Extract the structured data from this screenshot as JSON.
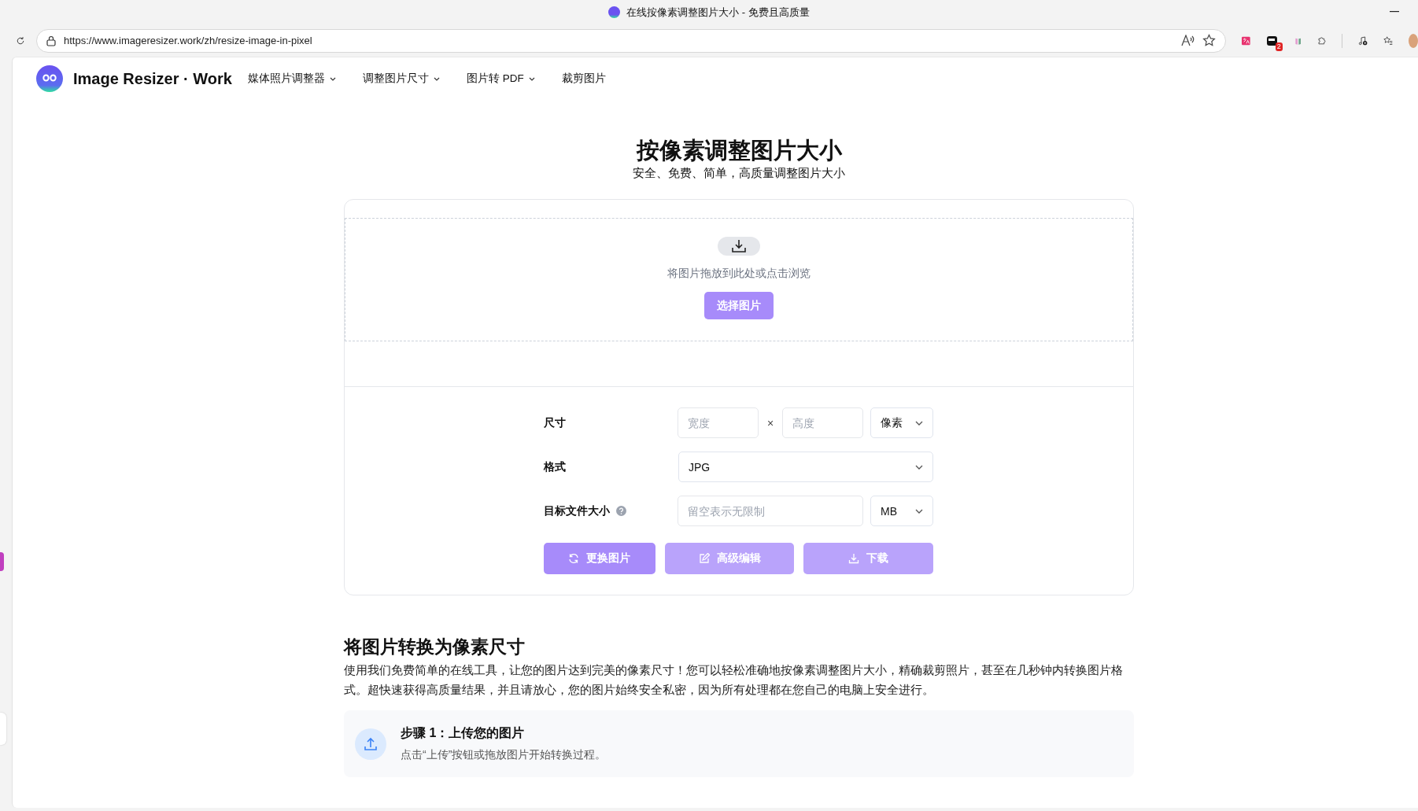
{
  "browser": {
    "tab_title": "在线按像素调整图片大小 - 免费且高质量",
    "url": "https://www.imageresizer.work/zh/resize-image-in-pixel",
    "extension_badge": "2"
  },
  "site": {
    "brand": "Image Resizer · Work",
    "nav": [
      {
        "label": "媒体照片调整器",
        "dropdown": true
      },
      {
        "label": "调整图片尺寸",
        "dropdown": true
      },
      {
        "label": "图片转 PDF",
        "dropdown": true
      },
      {
        "label": "裁剪图片",
        "dropdown": false
      }
    ]
  },
  "hero": {
    "title": "按像素调整图片大小",
    "subtitle": "安全、免费、简单，高质量调整图片大小"
  },
  "upload": {
    "hint": "将图片拖放到此处或点击浏览",
    "button": "选择图片"
  },
  "size": {
    "label": "尺寸",
    "width_placeholder": "宽度",
    "separator": "×",
    "height_placeholder": "高度",
    "unit": "像素"
  },
  "format": {
    "label": "格式",
    "value": "JPG"
  },
  "target_size": {
    "label": "目标文件大小",
    "placeholder": "留空表示无限制",
    "unit": "MB"
  },
  "actions": [
    {
      "label": "更换图片",
      "kind": "refresh",
      "disabled": false
    },
    {
      "label": "高级编辑",
      "kind": "edit",
      "disabled": true
    },
    {
      "label": "下载",
      "kind": "download",
      "disabled": true
    }
  ],
  "article": {
    "title": "将图片转换为像素尺寸",
    "body": "使用我们免费简单的在线工具，让您的图片达到完美的像素尺寸！您可以轻松准确地按像素调整图片大小，精确裁剪照片，甚至在几秒钟内转换图片格式。超快速获得高质量结果，并且请放心，您的图片始终安全私密，因为所有处理都在您自己的电脑上安全进行。",
    "steps": [
      {
        "title": "步骤 1：上传您的图片",
        "text": "点击“上传”按钮或拖放图片开始转换过程。"
      }
    ]
  }
}
